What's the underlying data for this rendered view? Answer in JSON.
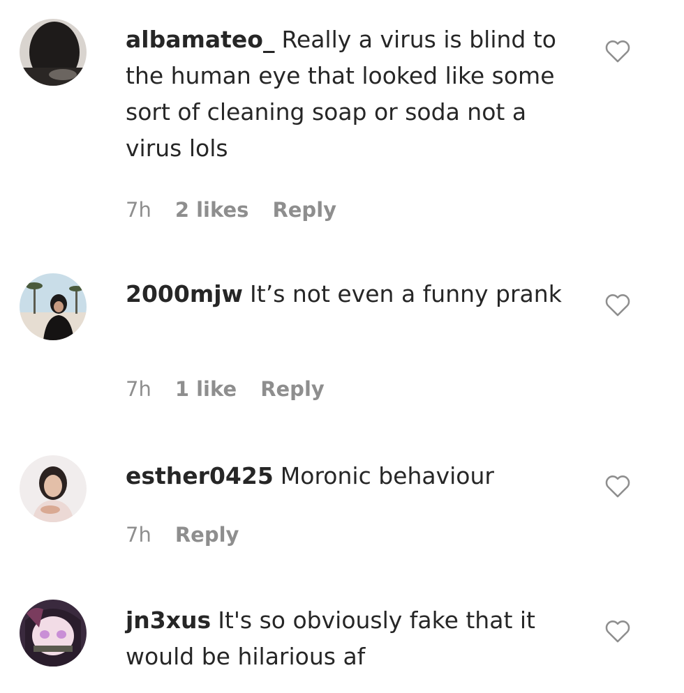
{
  "comments": [
    {
      "username": "albamateo_",
      "text": "Really a virus is blind to the human eye that looked like some sort of cleaning soap or soda not a virus lols",
      "time": "7h",
      "likes": "2 likes",
      "reply": "Reply",
      "avatar_icon": "avatar-dark-photo-icon",
      "like_icon": "heart-outline-icon"
    },
    {
      "username": "2000mjw",
      "text": "It’s not even a funny prank",
      "time": "7h",
      "likes": "1 like",
      "reply": "Reply",
      "avatar_icon": "avatar-beach-photo-icon",
      "like_icon": "heart-outline-icon"
    },
    {
      "username": "esther0425",
      "text": "Moronic behaviour",
      "time": "7h",
      "reply": "Reply",
      "avatar_icon": "avatar-portrait-photo-icon",
      "like_icon": "heart-outline-icon"
    },
    {
      "username": "jn3xus",
      "text": "It's so obviously fake that it would be hilarious af",
      "avatar_icon": "avatar-anime-photo-icon",
      "like_icon": "heart-outline-icon"
    }
  ],
  "colors": {
    "text": "#262626",
    "secondary": "#8e8e8e",
    "background": "#ffffff"
  }
}
